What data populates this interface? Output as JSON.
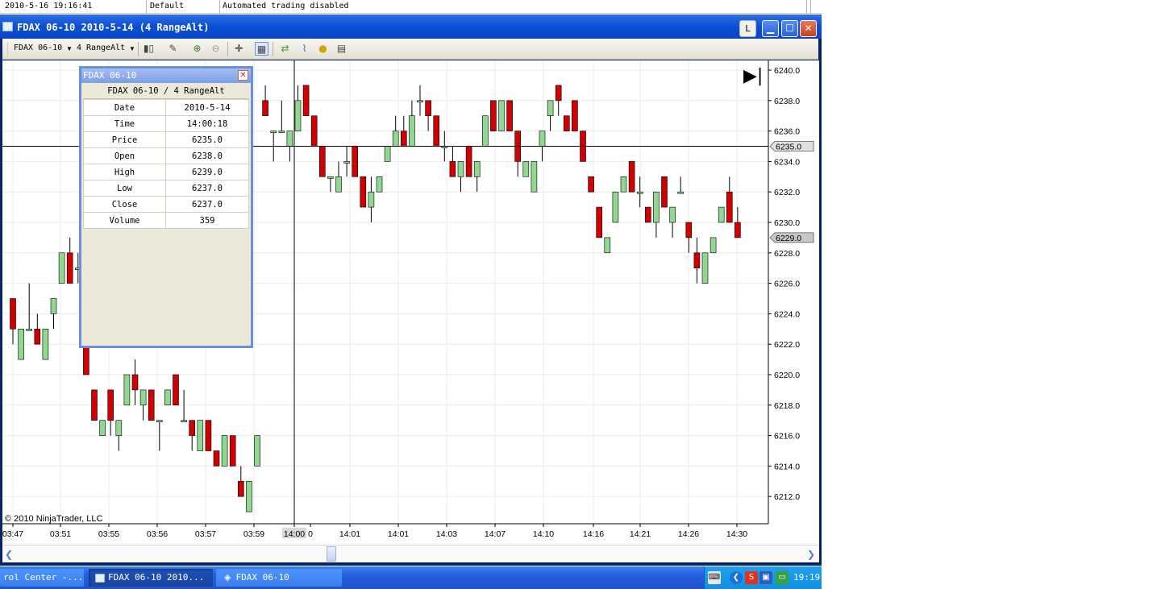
{
  "log": {
    "time": "2010-5-16 19:16:41",
    "account": "Default",
    "message": "Automated trading disabled"
  },
  "window": {
    "title": "FDAX 06-10  2010-5-14 (4 RangeAlt)",
    "icon": "chart-icon",
    "buttons": [
      "L",
      "minimize-icon",
      "maximize-icon",
      "close-icon"
    ]
  },
  "toolbar": {
    "instrument": "FDAX 06-10",
    "period": "4 RangeAlt",
    "icons": [
      "candlestick-icon",
      "pencil-icon",
      "zoom-in-icon",
      "zoom-out-icon",
      "crosshair-icon",
      "databox-icon",
      "strategies-icon",
      "indicators-icon",
      "coin-icon",
      "properties-icon"
    ]
  },
  "databox": {
    "title": "FDAX 06-10",
    "header": "FDAX 06-10 / 4 RangeAlt",
    "rows": [
      {
        "label": "Date",
        "value": "2010-5-14"
      },
      {
        "label": "Time",
        "value": "14:00:18"
      },
      {
        "label": "Price",
        "value": "6235.0"
      },
      {
        "label": "Open",
        "value": "6238.0"
      },
      {
        "label": "High",
        "value": "6239.0"
      },
      {
        "label": "Low",
        "value": "6237.0"
      },
      {
        "label": "Close",
        "value": "6237.0"
      },
      {
        "label": "Volume",
        "value": "359"
      }
    ]
  },
  "chart_data": {
    "type": "candlestick",
    "ylim": [
      6210.0,
      6241.0
    ],
    "y_ticks": [
      "6240.0",
      "6238.0",
      "6236.0",
      "6234.0",
      "6232.0",
      "6230.0",
      "6228.0",
      "6226.0",
      "6224.0",
      "6222.0",
      "6220.0",
      "6218.0",
      "6216.0",
      "6214.0",
      "6212.0"
    ],
    "x_ticks": [
      "03:47",
      "03:51",
      "03:55",
      "03:56",
      "03:57",
      "03:59",
      "14:00",
      "0",
      "14:01",
      "14:01",
      "14:03",
      "14:07",
      "14:10",
      "14:16",
      "14:21",
      "14:26",
      "14:30"
    ],
    "crosshair_price": "6235.0",
    "last_price": "6229.0",
    "copyright": "© 2010 NinjaTrader, LLC",
    "up_color": "#90d890",
    "down_color": "#d00000",
    "candles": [
      {
        "o": 6225,
        "h": 6225,
        "l": 6222,
        "c": 6223
      },
      {
        "o": 6221,
        "h": 6223,
        "l": 6221,
        "c": 6223
      },
      {
        "o": 6223,
        "h": 6226,
        "l": 6223,
        "c": 6223
      },
      {
        "o": 6223,
        "h": 6224,
        "l": 6222,
        "c": 6222
      },
      {
        "o": 6221,
        "h": 6223,
        "l": 6221,
        "c": 6223
      },
      {
        "o": 6224,
        "h": 6225,
        "l": 6223,
        "c": 6225
      },
      {
        "o": 6226,
        "h": 6228,
        "l": 6226,
        "c": 6228
      },
      {
        "o": 6228,
        "h": 6229,
        "l": 6226,
        "c": 6226
      },
      {
        "o": 6227,
        "h": 6228,
        "l": 6226,
        "c": 6227
      },
      {
        "o": 6222,
        "h": 6222,
        "l": 6220,
        "c": 6220
      },
      {
        "o": 6219,
        "h": 6219,
        "l": 6217,
        "c": 6217
      },
      {
        "o": 6216,
        "h": 6217,
        "l": 6216,
        "c": 6217
      },
      {
        "o": 6219,
        "h": 6219,
        "l": 6216,
        "c": 6217
      },
      {
        "o": 6216,
        "h": 6217,
        "l": 6215,
        "c": 6217
      },
      {
        "o": 6218,
        "h": 6220,
        "l": 6218,
        "c": 6220
      },
      {
        "o": 6220,
        "h": 6221,
        "l": 6218,
        "c": 6219
      },
      {
        "o": 6218,
        "h": 6219,
        "l": 6217,
        "c": 6219
      },
      {
        "o": 6219,
        "h": 6219,
        "l": 6217,
        "c": 6217
      },
      {
        "o": 6217,
        "h": 6217,
        "l": 6215,
        "c": 6217
      },
      {
        "o": 6218,
        "h": 6219,
        "l": 6218,
        "c": 6219
      },
      {
        "o": 6220,
        "h": 6220,
        "l": 6218,
        "c": 6218
      },
      {
        "o": 6217,
        "h": 6219,
        "l": 6217,
        "c": 6217
      },
      {
        "o": 6217,
        "h": 6217,
        "l": 6215,
        "c": 6216
      },
      {
        "o": 6215,
        "h": 6217,
        "l": 6215,
        "c": 6217
      },
      {
        "o": 6217,
        "h": 6217,
        "l": 6215,
        "c": 6215
      },
      {
        "o": 6215,
        "h": 6215,
        "l": 6214,
        "c": 6214
      },
      {
        "o": 6214,
        "h": 6216,
        "l": 6214,
        "c": 6216
      },
      {
        "o": 6216,
        "h": 6216,
        "l": 6214,
        "c": 6214
      },
      {
        "o": 6213,
        "h": 6214,
        "l": 6212,
        "c": 6212
      },
      {
        "o": 6211,
        "h": 6213,
        "l": 6211,
        "c": 6213
      },
      {
        "o": 6214,
        "h": 6216,
        "l": 6214,
        "c": 6216
      },
      {
        "o": 6238,
        "h": 6239,
        "l": 6237,
        "c": 6237
      },
      {
        "o": 6236,
        "h": 6236,
        "l": 6234,
        "c": 6236
      },
      {
        "o": 6236,
        "h": 6238,
        "l": 6236,
        "c": 6236
      },
      {
        "o": 6235,
        "h": 6236,
        "l": 6234,
        "c": 6236
      },
      {
        "o": 6236,
        "h": 6239,
        "l": 6236,
        "c": 6238
      },
      {
        "o": 6239,
        "h": 6239,
        "l": 6237,
        "c": 6237
      },
      {
        "o": 6237,
        "h": 6237,
        "l": 6235,
        "c": 6235
      },
      {
        "o": 6235,
        "h": 6235,
        "l": 6233,
        "c": 6233
      },
      {
        "o": 6233,
        "h": 6233,
        "l": 6232,
        "c": 6233
      },
      {
        "o": 6232,
        "h": 6234,
        "l": 6232,
        "c": 6233
      },
      {
        "o": 6234,
        "h": 6235,
        "l": 6233,
        "c": 6234
      },
      {
        "o": 6235,
        "h": 6235,
        "l": 6233,
        "c": 6233
      },
      {
        "o": 6233,
        "h": 6233,
        "l": 6231,
        "c": 6231
      },
      {
        "o": 6231,
        "h": 6233,
        "l": 6230,
        "c": 6232
      },
      {
        "o": 6232,
        "h": 6233,
        "l": 6232,
        "c": 6233
      },
      {
        "o": 6234,
        "h": 6235,
        "l": 6234,
        "c": 6235
      },
      {
        "o": 6235,
        "h": 6237,
        "l": 6235,
        "c": 6236
      },
      {
        "o": 6236,
        "h": 6237,
        "l": 6235,
        "c": 6235
      },
      {
        "o": 6235,
        "h": 6238,
        "l": 6235,
        "c": 6237
      },
      {
        "o": 6238,
        "h": 6239,
        "l": 6237,
        "c": 6238
      },
      {
        "o": 6238,
        "h": 6238,
        "l": 6236,
        "c": 6237
      },
      {
        "o": 6237,
        "h": 6237,
        "l": 6235,
        "c": 6235
      },
      {
        "o": 6235,
        "h": 6236,
        "l": 6234,
        "c": 6235
      },
      {
        "o": 6234,
        "h": 6235,
        "l": 6233,
        "c": 6233
      },
      {
        "o": 6233,
        "h": 6234,
        "l": 6232,
        "c": 6234
      },
      {
        "o": 6235,
        "h": 6235,
        "l": 6233,
        "c": 6233
      },
      {
        "o": 6233,
        "h": 6234,
        "l": 6232,
        "c": 6234
      },
      {
        "o": 6235,
        "h": 6237,
        "l": 6235,
        "c": 6237
      },
      {
        "o": 6238,
        "h": 6238,
        "l": 6236,
        "c": 6236
      },
      {
        "o": 6236,
        "h": 6238,
        "l": 6236,
        "c": 6238
      },
      {
        "o": 6238,
        "h": 6238,
        "l": 6236,
        "c": 6236
      },
      {
        "o": 6236,
        "h": 6236,
        "l": 6233,
        "c": 6234
      },
      {
        "o": 6233,
        "h": 6234,
        "l": 6233,
        "c": 6234
      },
      {
        "o": 6232,
        "h": 6234,
        "l": 6232,
        "c": 6234
      },
      {
        "o": 6235,
        "h": 6236,
        "l": 6234,
        "c": 6236
      },
      {
        "o": 6237,
        "h": 6238,
        "l": 6236,
        "c": 6238
      },
      {
        "o": 6239,
        "h": 6239,
        "l": 6237,
        "c": 6238
      },
      {
        "o": 6237,
        "h": 6237,
        "l": 6236,
        "c": 6236
      },
      {
        "o": 6238,
        "h": 6238,
        "l": 6236,
        "c": 6236
      },
      {
        "o": 6236,
        "h": 6236,
        "l": 6234,
        "c": 6234
      },
      {
        "o": 6233,
        "h": 6233,
        "l": 6232,
        "c": 6232
      },
      {
        "o": 6231,
        "h": 6231,
        "l": 6229,
        "c": 6229
      },
      {
        "o": 6228,
        "h": 6229,
        "l": 6228,
        "c": 6229
      },
      {
        "o": 6230,
        "h": 6232,
        "l": 6230,
        "c": 6232
      },
      {
        "o": 6232,
        "h": 6233,
        "l": 6232,
        "c": 6233
      },
      {
        "o": 6234,
        "h": 6234,
        "l": 6232,
        "c": 6232
      },
      {
        "o": 6232,
        "h": 6233,
        "l": 6231,
        "c": 6232
      },
      {
        "o": 6231,
        "h": 6231,
        "l": 6230,
        "c": 6230
      },
      {
        "o": 6230,
        "h": 6232,
        "l": 6229,
        "c": 6232
      },
      {
        "o": 6233,
        "h": 6233,
        "l": 6231,
        "c": 6231
      },
      {
        "o": 6230,
        "h": 6231,
        "l": 6229,
        "c": 6231
      },
      {
        "o": 6232,
        "h": 6233,
        "l": 6232,
        "c": 6232
      },
      {
        "o": 6230,
        "h": 6230,
        "l": 6228,
        "c": 6229
      },
      {
        "o": 6228,
        "h": 6229,
        "l": 6226,
        "c": 6227
      },
      {
        "o": 6226,
        "h": 6228,
        "l": 6226,
        "c": 6228
      },
      {
        "o": 6228,
        "h": 6229,
        "l": 6228,
        "c": 6229
      },
      {
        "o": 6230,
        "h": 6231,
        "l": 6230,
        "c": 6231
      },
      {
        "o": 6232,
        "h": 6233,
        "l": 6231,
        "c": 6230
      },
      {
        "o": 6230,
        "h": 6231,
        "l": 6229,
        "c": 6229
      }
    ]
  },
  "scrollbar": {
    "left": "left-arrow-icon",
    "right": "right-arrow-icon"
  },
  "taskbar": {
    "items": [
      "rol Center -...",
      "FDAX 06-10  2010...",
      "FDAX 06-10"
    ],
    "clock": "19:19"
  }
}
